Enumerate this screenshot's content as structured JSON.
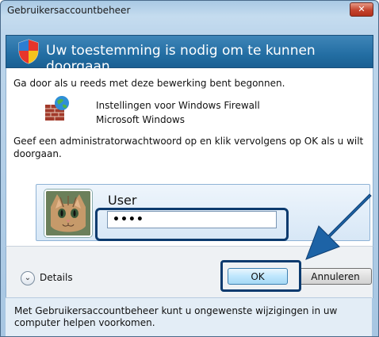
{
  "window": {
    "title": "Gebruikersaccountbeheer",
    "close_glyph": "✕"
  },
  "banner": {
    "text": "Uw toestemming is nodig om te kunnen doorgaan",
    "icon": "uac-shield-icon",
    "color": "#2a72a8"
  },
  "content": {
    "intro": "Ga door als u reeds met deze bewerking bent begonnen.",
    "program_name": "Instellingen voor Windows Firewall",
    "publisher": "Microsoft Windows",
    "instruction_line1": "Geef een administratorwachtwoord op en klik vervolgens op OK als u wilt",
    "instruction_line2": "doorgaan."
  },
  "credential": {
    "user_name": "User",
    "password_mask": "••••",
    "avatar_icon": "cat-avatar"
  },
  "footer": {
    "details_label": "Details",
    "details_glyph": "⌄",
    "ok_label": "OK",
    "cancel_label": "Annuleren"
  },
  "note": {
    "line1": "Met Gebruikersaccountbeheer kunt u ongewenste wijzigingen in uw",
    "line2": "computer helpen voorkomen."
  },
  "annotation": {
    "highlight_color": "#0b3a6e",
    "arrow_color": "#1d63a6"
  }
}
